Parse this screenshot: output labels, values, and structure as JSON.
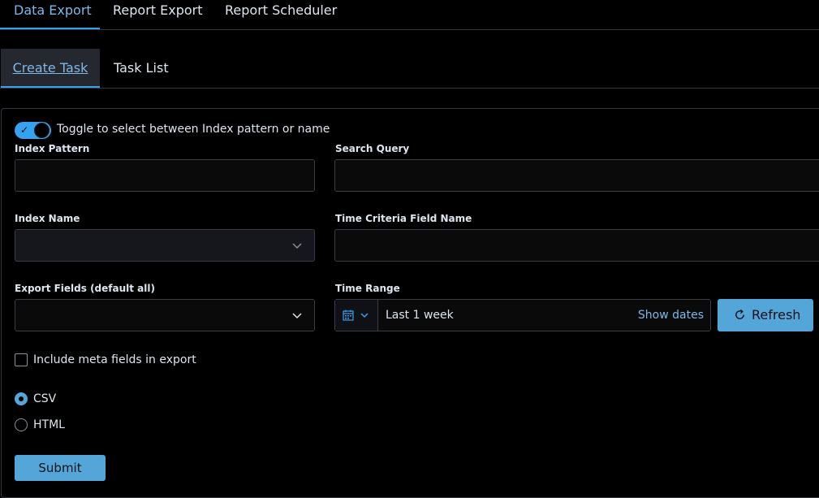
{
  "top_tabs": [
    {
      "label": "Data Export",
      "active": true
    },
    {
      "label": "Report Export",
      "active": false
    },
    {
      "label": "Report Scheduler",
      "active": false
    }
  ],
  "sub_tabs": [
    {
      "label": "Create Task",
      "active": true
    },
    {
      "label": "Task List",
      "active": false
    }
  ],
  "form": {
    "toggle": {
      "label": "Toggle to select between Index pattern or name",
      "on": true
    },
    "index_pattern": {
      "label": "Index Pattern",
      "value": ""
    },
    "search_query": {
      "label": "Search Query",
      "value": ""
    },
    "index_name": {
      "label": "Index Name",
      "value": ""
    },
    "time_field": {
      "label": "Time Criteria Field Name",
      "value": ""
    },
    "export_fields": {
      "label": "Export Fields (default all)",
      "value": ""
    },
    "time_range": {
      "label": "Time Range",
      "value": "Last 1 week",
      "show_dates": "Show dates",
      "refresh": "Refresh"
    },
    "meta_fields": {
      "label": "Include meta fields in export",
      "checked": false
    },
    "formats": [
      {
        "label": "CSV",
        "checked": true
      },
      {
        "label": "HTML",
        "checked": false
      }
    ],
    "submit": "Submit"
  },
  "colors": {
    "accent": "#36a2ef",
    "button": "#55a6d8",
    "background": "#000000"
  },
  "icons": [
    "calendar-icon",
    "chevron-down-icon",
    "refresh-icon",
    "check-icon"
  ]
}
